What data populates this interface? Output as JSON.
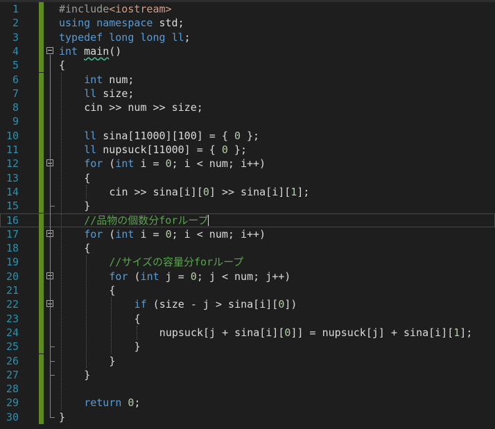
{
  "editor": {
    "current_line": 16,
    "accent_colors": {
      "keyword": "#569cd6",
      "comment": "#57a64a",
      "line_number": "#2b91af",
      "change_bar": "#5e8b1f"
    },
    "lines": [
      {
        "num": "1",
        "indent": 0,
        "tokens": [
          {
            "t": "#include",
            "c": "pp"
          },
          {
            "t": "<iostream>",
            "c": "hd"
          }
        ]
      },
      {
        "num": "2",
        "indent": 0,
        "tokens": [
          {
            "t": "using",
            "c": "kw"
          },
          {
            "t": " "
          },
          {
            "t": "namespace",
            "c": "kw"
          },
          {
            "t": " std;"
          }
        ]
      },
      {
        "num": "3",
        "indent": 0,
        "tokens": [
          {
            "t": "typedef",
            "c": "kw"
          },
          {
            "t": " "
          },
          {
            "t": "long",
            "c": "kw"
          },
          {
            "t": " "
          },
          {
            "t": "long",
            "c": "kw"
          },
          {
            "t": " "
          },
          {
            "t": "ll",
            "c": "kw"
          },
          {
            "t": ";"
          }
        ]
      },
      {
        "num": "4",
        "indent": 0,
        "tokens": [
          {
            "t": "int",
            "c": "kw"
          },
          {
            "t": " "
          },
          {
            "t": "main",
            "c": "fn"
          },
          {
            "t": "()"
          }
        ]
      },
      {
        "num": "5",
        "indent": 0,
        "tokens": [
          {
            "t": "{"
          }
        ]
      },
      {
        "num": "6",
        "indent": 4,
        "tokens": [
          {
            "t": "int",
            "c": "kw"
          },
          {
            "t": " num;"
          }
        ]
      },
      {
        "num": "7",
        "indent": 4,
        "tokens": [
          {
            "t": "ll",
            "c": "kw"
          },
          {
            "t": " size;"
          }
        ]
      },
      {
        "num": "8",
        "indent": 4,
        "tokens": [
          {
            "t": "cin >> num >> size;"
          }
        ]
      },
      {
        "num": "9",
        "indent": 0,
        "tokens": []
      },
      {
        "num": "10",
        "indent": 4,
        "tokens": [
          {
            "t": "ll",
            "c": "kw"
          },
          {
            "t": " sina[11000][100] = { "
          },
          {
            "t": "0",
            "c": "nm"
          },
          {
            "t": " };"
          }
        ]
      },
      {
        "num": "11",
        "indent": 4,
        "tokens": [
          {
            "t": "ll",
            "c": "kw"
          },
          {
            "t": " nupsuck[11000] = { "
          },
          {
            "t": "0",
            "c": "nm"
          },
          {
            "t": " };"
          }
        ]
      },
      {
        "num": "12",
        "indent": 4,
        "tokens": [
          {
            "t": "for",
            "c": "kw"
          },
          {
            "t": " ("
          },
          {
            "t": "int",
            "c": "kw"
          },
          {
            "t": " i = "
          },
          {
            "t": "0",
            "c": "nm"
          },
          {
            "t": "; i < num; i++)"
          }
        ]
      },
      {
        "num": "13",
        "indent": 4,
        "tokens": [
          {
            "t": "{"
          }
        ]
      },
      {
        "num": "14",
        "indent": 8,
        "tokens": [
          {
            "t": "cin >> sina[i]["
          },
          {
            "t": "0",
            "c": "nm"
          },
          {
            "t": "] >> sina[i]["
          },
          {
            "t": "1",
            "c": "nm"
          },
          {
            "t": "];"
          }
        ]
      },
      {
        "num": "15",
        "indent": 4,
        "tokens": [
          {
            "t": "}"
          }
        ]
      },
      {
        "num": "16",
        "indent": 4,
        "tokens": [
          {
            "t": "//品物の個数分forループ",
            "c": "cm"
          }
        ]
      },
      {
        "num": "17",
        "indent": 4,
        "tokens": [
          {
            "t": "for",
            "c": "kw"
          },
          {
            "t": " ("
          },
          {
            "t": "int",
            "c": "kw"
          },
          {
            "t": " i = "
          },
          {
            "t": "0",
            "c": "nm"
          },
          {
            "t": "; i < num; i++)"
          }
        ]
      },
      {
        "num": "18",
        "indent": 4,
        "tokens": [
          {
            "t": "{"
          }
        ]
      },
      {
        "num": "19",
        "indent": 8,
        "tokens": [
          {
            "t": "//サイズの容量分forループ",
            "c": "cm"
          }
        ]
      },
      {
        "num": "20",
        "indent": 8,
        "tokens": [
          {
            "t": "for",
            "c": "kw"
          },
          {
            "t": " ("
          },
          {
            "t": "int",
            "c": "kw"
          },
          {
            "t": " j = "
          },
          {
            "t": "0",
            "c": "nm"
          },
          {
            "t": "; j < num; j++)"
          }
        ]
      },
      {
        "num": "21",
        "indent": 8,
        "tokens": [
          {
            "t": "{"
          }
        ]
      },
      {
        "num": "22",
        "indent": 12,
        "tokens": [
          {
            "t": "if",
            "c": "kw"
          },
          {
            "t": " (size - j > sina[i]["
          },
          {
            "t": "0",
            "c": "nm"
          },
          {
            "t": "])"
          }
        ]
      },
      {
        "num": "23",
        "indent": 12,
        "tokens": [
          {
            "t": "{"
          }
        ]
      },
      {
        "num": "24",
        "indent": 16,
        "tokens": [
          {
            "t": "nupsuck[j + sina[i]["
          },
          {
            "t": "0",
            "c": "nm"
          },
          {
            "t": "]] = nupsuck[j] + sina[i]["
          },
          {
            "t": "1",
            "c": "nm"
          },
          {
            "t": "];"
          }
        ]
      },
      {
        "num": "25",
        "indent": 12,
        "tokens": [
          {
            "t": "}"
          }
        ]
      },
      {
        "num": "26",
        "indent": 8,
        "tokens": [
          {
            "t": "}"
          }
        ]
      },
      {
        "num": "27",
        "indent": 4,
        "tokens": [
          {
            "t": "}"
          }
        ]
      },
      {
        "num": "28",
        "indent": 0,
        "tokens": []
      },
      {
        "num": "29",
        "indent": 4,
        "tokens": [
          {
            "t": "return",
            "c": "kw"
          },
          {
            "t": " "
          },
          {
            "t": "0",
            "c": "nm"
          },
          {
            "t": ";"
          }
        ]
      },
      {
        "num": "30",
        "indent": 0,
        "tokens": [
          {
            "t": "}"
          }
        ]
      }
    ]
  }
}
